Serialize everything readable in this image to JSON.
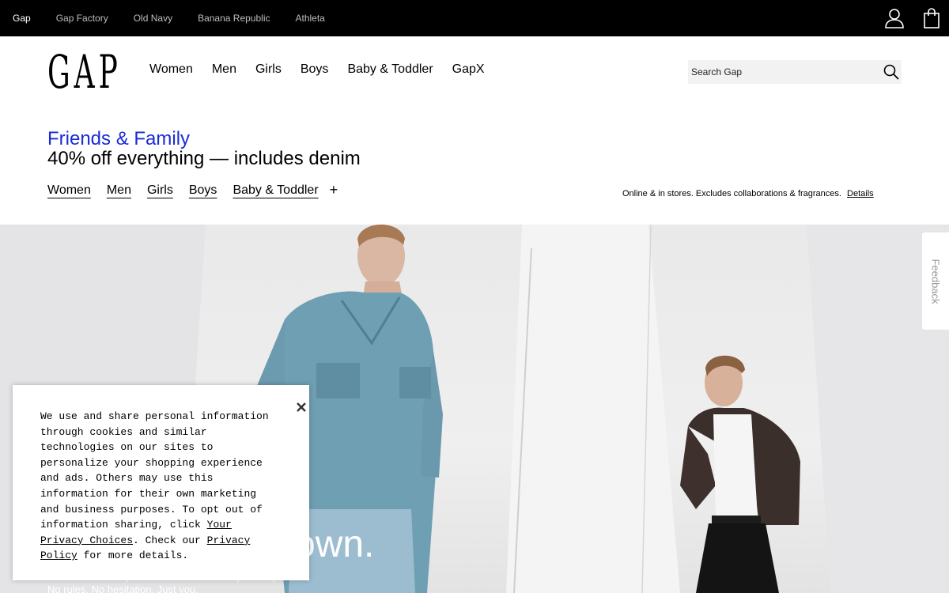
{
  "brand_bar": {
    "brands": [
      {
        "label": "Gap",
        "active": true
      },
      {
        "label": "Gap Factory"
      },
      {
        "label": "Old Navy"
      },
      {
        "label": "Banana Republic"
      },
      {
        "label": "Athleta"
      }
    ],
    "icons": [
      "account-icon",
      "shopping-bag-icon"
    ]
  },
  "header": {
    "logo": "GAP",
    "nav": [
      "Women",
      "Men",
      "Girls",
      "Boys",
      "Baby & Toddler",
      "GapX"
    ],
    "search": {
      "placeholder": "Search Gap",
      "value": "",
      "icon": "search-icon"
    }
  },
  "promo": {
    "eyebrow": "Friends & Family",
    "headline": "40% off everything — includes denim",
    "links": [
      "Women",
      "Men",
      "Girls",
      "Boys",
      "Baby & Toddler"
    ],
    "expand_icon": "plus-icon",
    "note": "Online & in stores. Excludes collaborations & fragrances.",
    "details_link": "Details",
    "eyebrow_color": "#1a2bd6"
  },
  "hero": {
    "headline_visible": "own.",
    "subtext_visible": "This is denim on your own terms. Wear it your way. No rules. No hesitation. Just you."
  },
  "feedback": {
    "label": "Feedback"
  },
  "cookie_notice": {
    "text_before": "We use and share personal information through cookies and similar technologies on our sites to personalize your shopping experience and ads. Others may use this information for their own marketing and business purposes. To opt out of information sharing, click ",
    "privacy_choices_link": "Your Privacy Choices",
    "text_middle": ". Check our ",
    "privacy_policy_link": "Privacy Policy",
    "text_after": " for more details.",
    "close_icon": "close-icon"
  }
}
